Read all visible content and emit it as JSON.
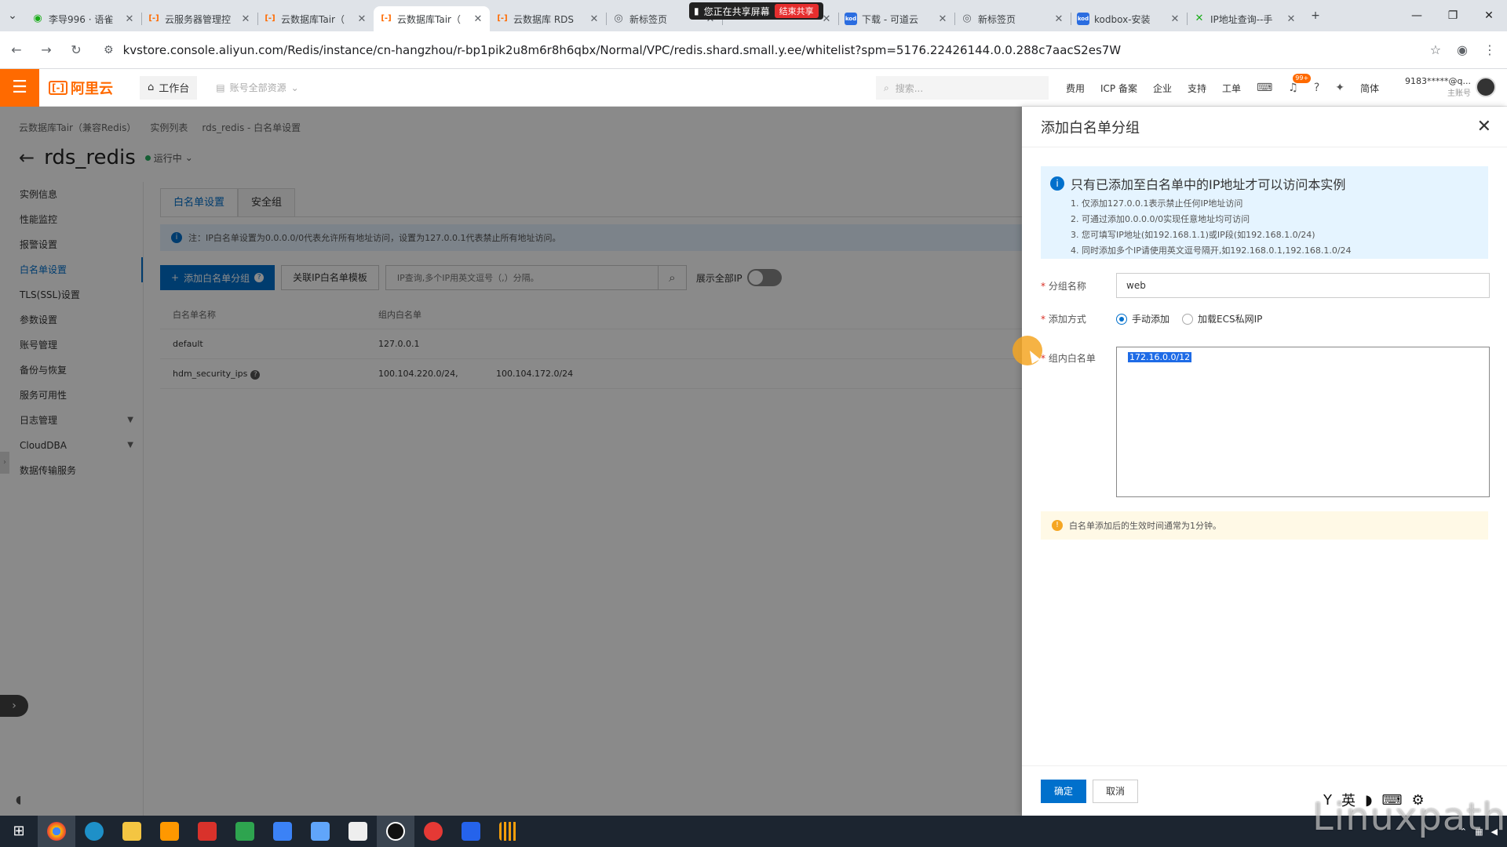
{
  "browser": {
    "tabs": [
      {
        "title": "李导996 · 语雀",
        "favicon": "green-icon",
        "active": false
      },
      {
        "title": "云服务器管理控",
        "favicon": "aliyun-icon",
        "active": false
      },
      {
        "title": "云数据库Tair（",
        "favicon": "aliyun-icon",
        "active": false
      },
      {
        "title": "云数据库Tair（",
        "favicon": "aliyun-icon",
        "active": true
      },
      {
        "title": "云数据库 RDS",
        "favicon": "aliyun-icon",
        "active": false
      },
      {
        "title": "新标签页",
        "favicon": "globe-icon",
        "active": false
      },
      {
        "title": "",
        "favicon": "",
        "active": false
      },
      {
        "title": "下载 - 可道云",
        "favicon": "kod-icon",
        "active": false
      },
      {
        "title": "新标签页",
        "favicon": "globe-icon",
        "active": false
      },
      {
        "title": "kodbox-安装",
        "favicon": "kod-icon",
        "active": false
      },
      {
        "title": "IP地址查询--手",
        "favicon": "ip-icon",
        "active": false
      }
    ],
    "share_banner": {
      "text": "您正在共享屏幕",
      "stop_label": "结束共享"
    },
    "url": "kvstore.console.aliyun.com/Redis/instance/cn-hangzhou/r-bp1pik2u8m6r8h6qbx/Normal/VPC/redis.shard.small.y.ee/whitelist?spm=5176.22426144.0.0.288c7aacS2es7W"
  },
  "console": {
    "logo": "阿里云",
    "workbench": "工作台",
    "account_scope": "账号全部资源",
    "search_placeholder": "搜索...",
    "nav_links": [
      "费用",
      "ICP 备案",
      "企业",
      "支持",
      "工单"
    ],
    "notification_badge": "99+",
    "lang": "简体",
    "user": "9183*****@q...",
    "user_role": "主账号"
  },
  "page": {
    "breadcrumb": [
      "云数据库Tair（兼容Redis）",
      "实例列表",
      "rds_redis - 白名单设置"
    ],
    "title": "rds_redis",
    "status": "运行中",
    "sidebar": [
      {
        "label": "实例信息"
      },
      {
        "label": "性能监控"
      },
      {
        "label": "报警设置"
      },
      {
        "label": "白名单设置",
        "active": true
      },
      {
        "label": "TLS(SSL)设置"
      },
      {
        "label": "参数设置"
      },
      {
        "label": "账号管理"
      },
      {
        "label": "备份与恢复"
      },
      {
        "label": "服务可用性"
      },
      {
        "label": "日志管理",
        "expandable": true
      },
      {
        "label": "CloudDBA",
        "expandable": true
      },
      {
        "label": "数据传输服务"
      }
    ],
    "tabs": [
      "白名单设置",
      "安全组"
    ],
    "notice": "注：IP白名单设置为0.0.0.0/0代表允许所有地址访问，设置为127.0.0.1代表禁止所有地址访问。",
    "add_group_button": "添加白名单分组",
    "link_template_button": "关联IP白名单模板",
    "search_placeholder": "IP查询,多个IP用英文逗号（,）分隔。",
    "show_all_ip": "展示全部IP",
    "table": {
      "headers": [
        "白名单名称",
        "组内白名单"
      ],
      "rows": [
        {
          "name": "default",
          "ips": [
            "127.0.0.1"
          ]
        },
        {
          "name": "hdm_security_ips",
          "ips": [
            "100.104.220.0/24,",
            "100.104.172.0/24"
          ]
        }
      ]
    }
  },
  "drawer": {
    "title": "添加白名单分组",
    "info_title": "只有已添加至白名单中的IP地址才可以访问本实例",
    "info_items": [
      "1. 仅添加127.0.0.1表示禁止任何IP地址访问",
      "2. 可通过添加0.0.0.0/0实现任意地址均可访问",
      "3. 您可填写IP地址(如192.168.1.1)或IP段(如192.168.1.0/24)",
      "4. 同时添加多个IP请使用英文逗号隔开,如192.168.0.1,192.168.1.0/24"
    ],
    "group_name_label": "分组名称",
    "group_name_value": "web",
    "add_method_label": "添加方式",
    "method_manual": "手动添加",
    "method_ecs": "加载ECS私网IP",
    "whitelist_label": "组内白名单",
    "whitelist_value": "172.16.0.0/12",
    "warning": "白名单添加后的生效时间通常为1分钟。",
    "ok_label": "确定",
    "cancel_label": "取消"
  },
  "ime": {
    "lang": "英"
  },
  "watermark": "Linuxpath"
}
